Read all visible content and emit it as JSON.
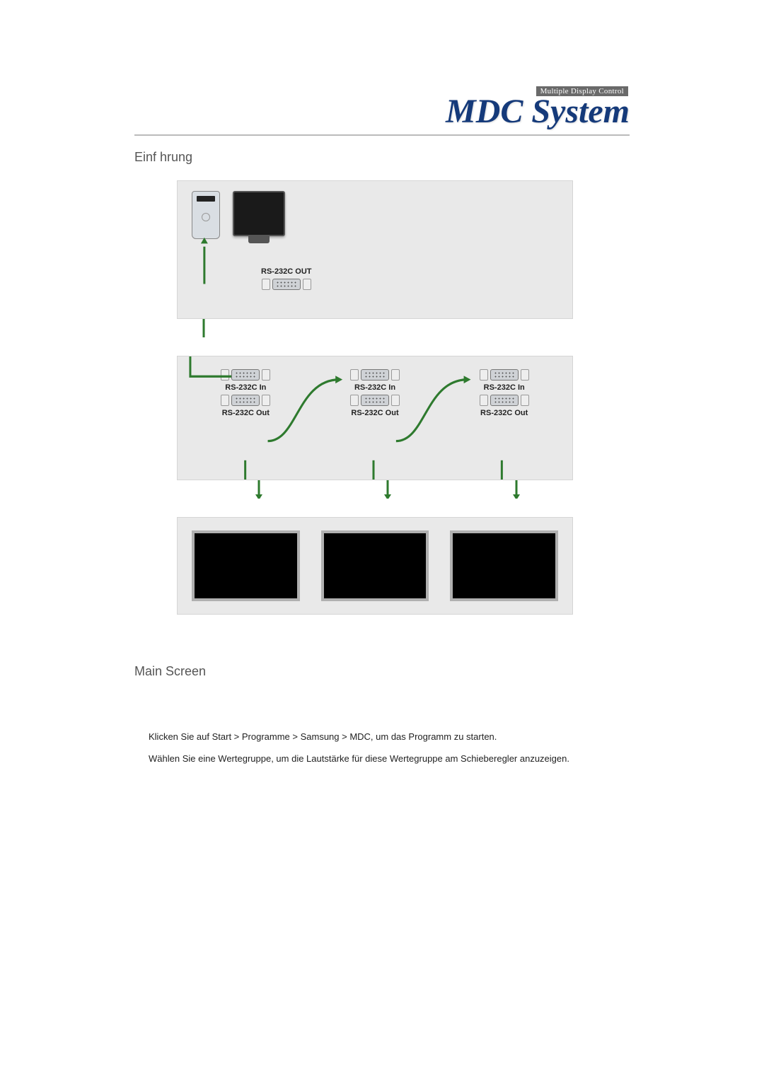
{
  "logo": {
    "tagline": "Multiple Display Control",
    "brand": "MDC System"
  },
  "sections": {
    "intro_title": "Einf hrung",
    "main_title": "Main Screen"
  },
  "diagram": {
    "source_port": "RS-232C OUT",
    "unit": {
      "in": "RS-232C In",
      "out": "RS-232C Out"
    }
  },
  "body": {
    "line1": "Klicken Sie auf Start > Programme > Samsung > MDC, um das Programm zu starten.",
    "line2": "Wählen Sie eine Wertegruppe, um die Lautstärke für diese Wertegruppe am Schieberegler anzuzeigen."
  }
}
